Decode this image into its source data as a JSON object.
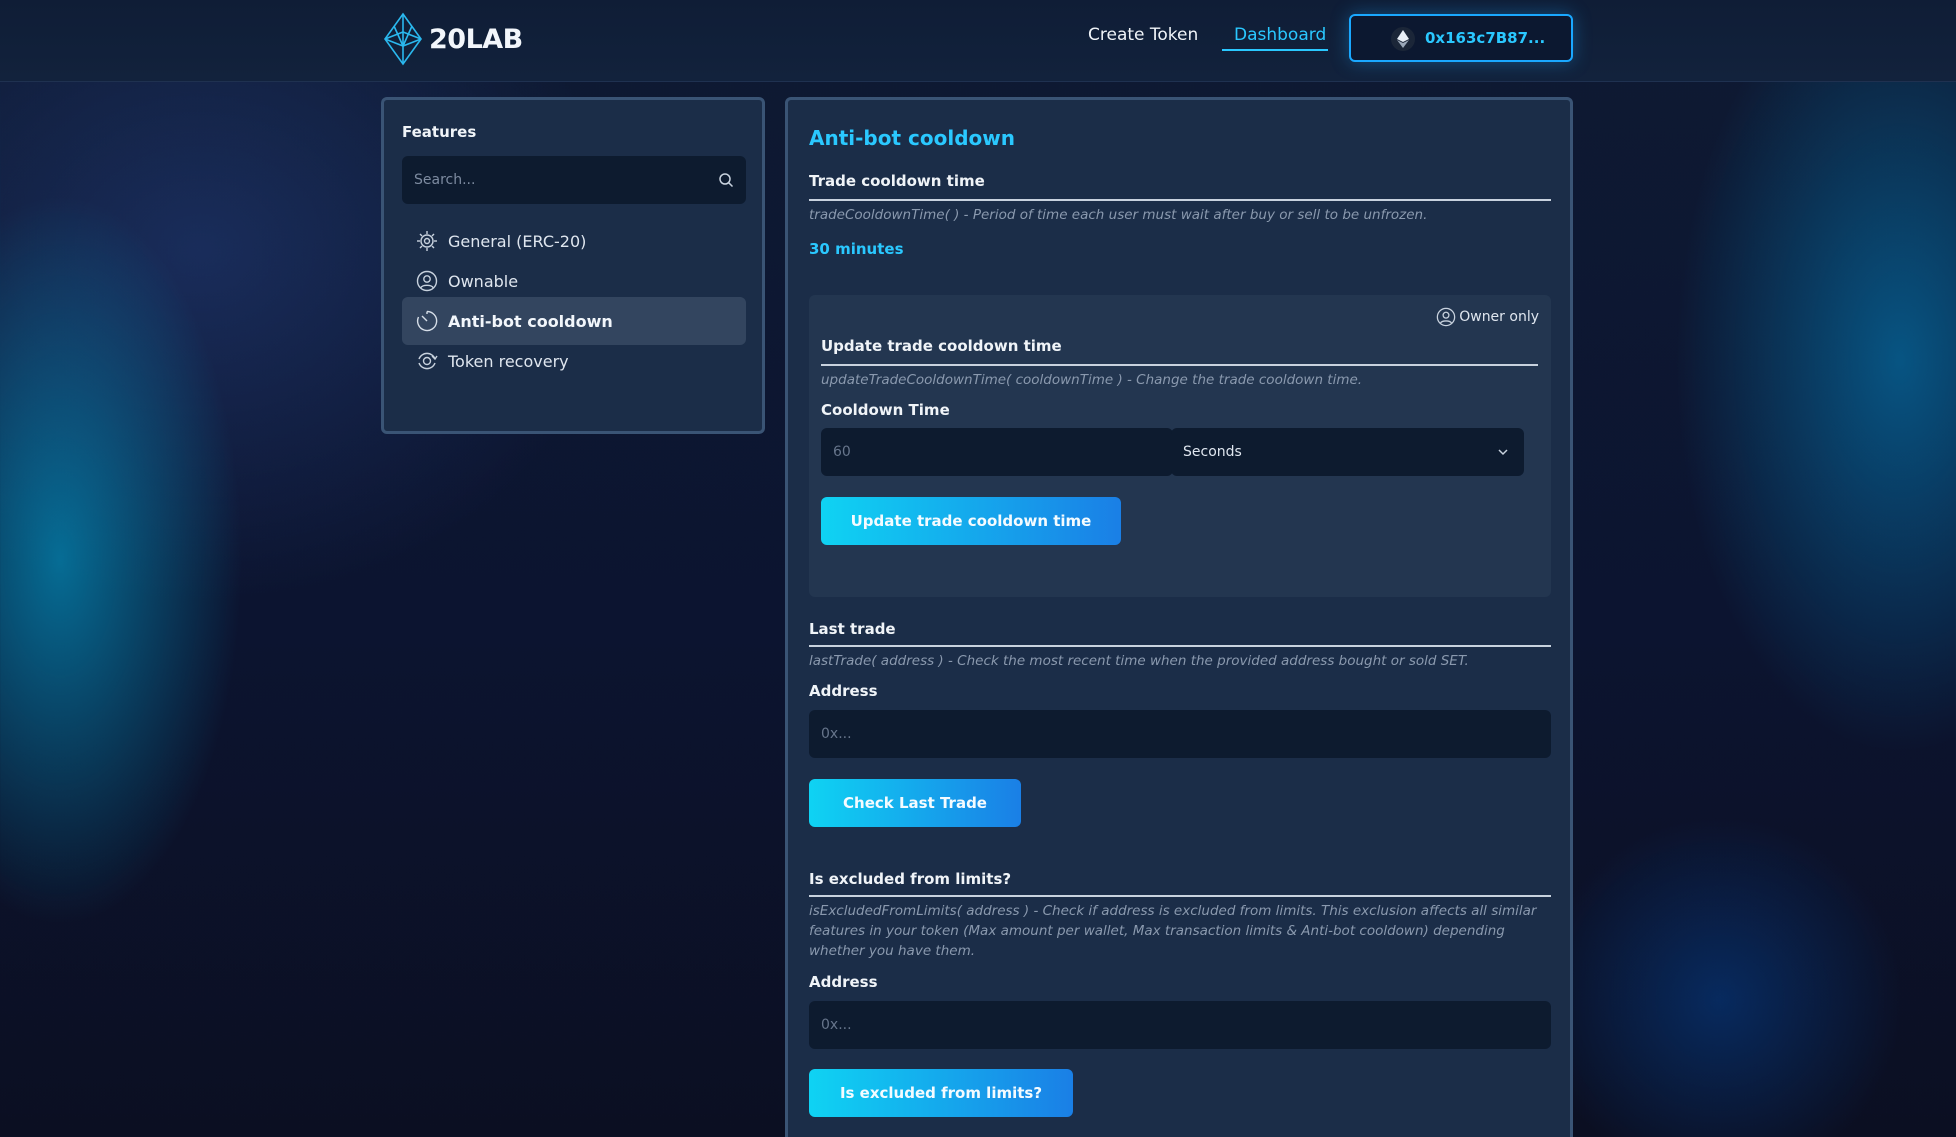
{
  "header": {
    "logo_text": "20LAB",
    "nav": [
      {
        "label": "Create Token"
      },
      {
        "label": "Dashboard"
      }
    ],
    "wallet_label": "0x163c7B87..."
  },
  "sidebar": {
    "title": "Features",
    "search_placeholder": "Search...",
    "items": [
      {
        "label": "General (ERC-20)",
        "icon": "chip-icon"
      },
      {
        "label": "Ownable",
        "icon": "user-circle-icon"
      },
      {
        "label": "Anti-bot cooldown",
        "icon": "timer-icon",
        "active": true
      },
      {
        "label": "Token recovery",
        "icon": "recovery-icon"
      }
    ]
  },
  "main": {
    "title": "Anti-bot cooldown",
    "trade_cooldown": {
      "title": "Trade cooldown time",
      "desc": "tradeCooldownTime( ) - Period of time each user must wait after buy or sell to be unfrozen.",
      "value": "30 minutes"
    },
    "update": {
      "badge": "Owner only",
      "title": "Update trade cooldown time",
      "desc": "updateTradeCooldownTime( cooldownTime ) - Change the trade cooldown time.",
      "field_label": "Cooldown Time",
      "placeholder": "60",
      "unit_selected": "Seconds",
      "button": "Update trade cooldown time"
    },
    "last_trade": {
      "title": "Last trade",
      "desc": "lastTrade( address ) - Check the most recent time when the provided address bought or sold SET.",
      "field_label": "Address",
      "placeholder": "0x...",
      "button": "Check Last Trade"
    },
    "excluded": {
      "title": "Is excluded from limits?",
      "desc": "isExcludedFromLimits( address ) - Check if address is excluded from limits. This exclusion affects all similar features in your token (Max amount per wallet, Max transaction limits & Anti-bot cooldown) depending whether you have them.",
      "field_label": "Address",
      "placeholder": "0x...",
      "button": "Is excluded from limits?"
    }
  },
  "colors": {
    "accent": "#2ac8ff",
    "button_gradient_start": "#0fd3f3",
    "button_gradient_end": "#1a7fe6",
    "panel": "#1b2d48"
  }
}
